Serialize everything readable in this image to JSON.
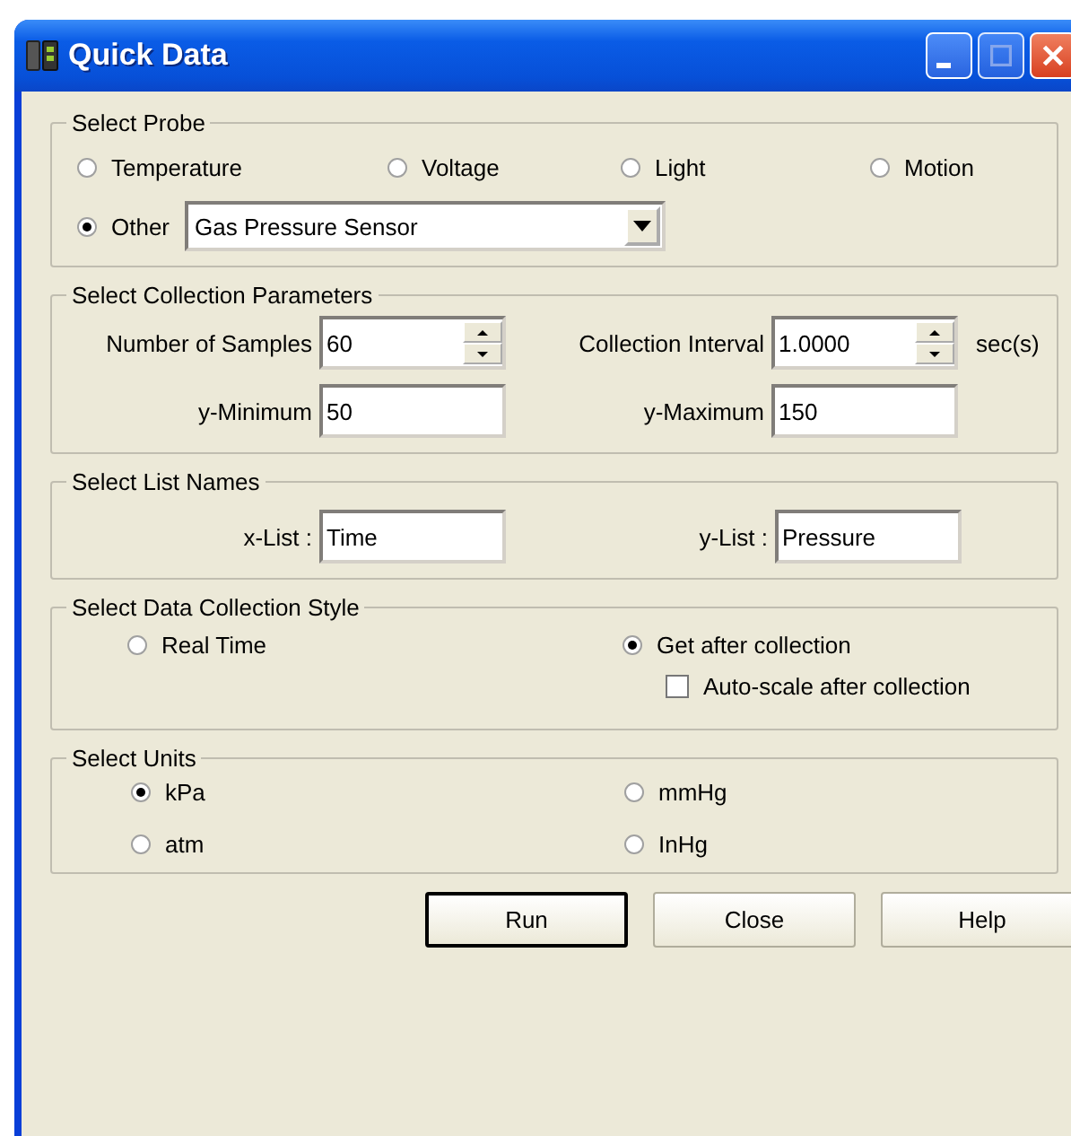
{
  "window": {
    "title": "Quick Data"
  },
  "probe": {
    "title": "Select Probe",
    "options": [
      {
        "label": "Temperature",
        "selected": false
      },
      {
        "label": "Voltage",
        "selected": false
      },
      {
        "label": "Light",
        "selected": false
      },
      {
        "label": "Motion",
        "selected": false
      },
      {
        "label": "Other",
        "selected": true
      }
    ],
    "sensor": "Gas Pressure Sensor"
  },
  "parameters": {
    "title": "Select Collection Parameters",
    "fields": [
      {
        "label": "Number of Samples",
        "value": "60",
        "kind": "spin"
      },
      {
        "label": "Collection Interval",
        "value": "1.0000",
        "kind": "spin",
        "unit": "sec(s)"
      },
      {
        "label": "y-Minimum",
        "value": "50",
        "kind": "text"
      },
      {
        "label": "y-Maximum",
        "value": "150",
        "kind": "text"
      }
    ]
  },
  "list_names": {
    "title": "Select List Names",
    "fields": [
      {
        "label": "x-List :",
        "value": "Time"
      },
      {
        "label": "y-List :",
        "value": "Pressure"
      }
    ]
  },
  "collection_style": {
    "title": "Select Data Collection Style",
    "options": [
      {
        "label": "Real Time",
        "selected": false
      },
      {
        "label": "Get after collection",
        "selected": true
      }
    ],
    "auto_scale": {
      "label": "Auto-scale after collection",
      "checked": false
    }
  },
  "units": {
    "title": "Select Units",
    "options": [
      {
        "label": "kPa",
        "selected": true
      },
      {
        "label": "mmHg",
        "selected": false
      },
      {
        "label": "atm",
        "selected": false
      },
      {
        "label": "InHg",
        "selected": false
      }
    ]
  },
  "buttons": [
    {
      "label": "Run",
      "default": true
    },
    {
      "label": "Close",
      "default": false
    },
    {
      "label": "Help",
      "default": false
    }
  ]
}
